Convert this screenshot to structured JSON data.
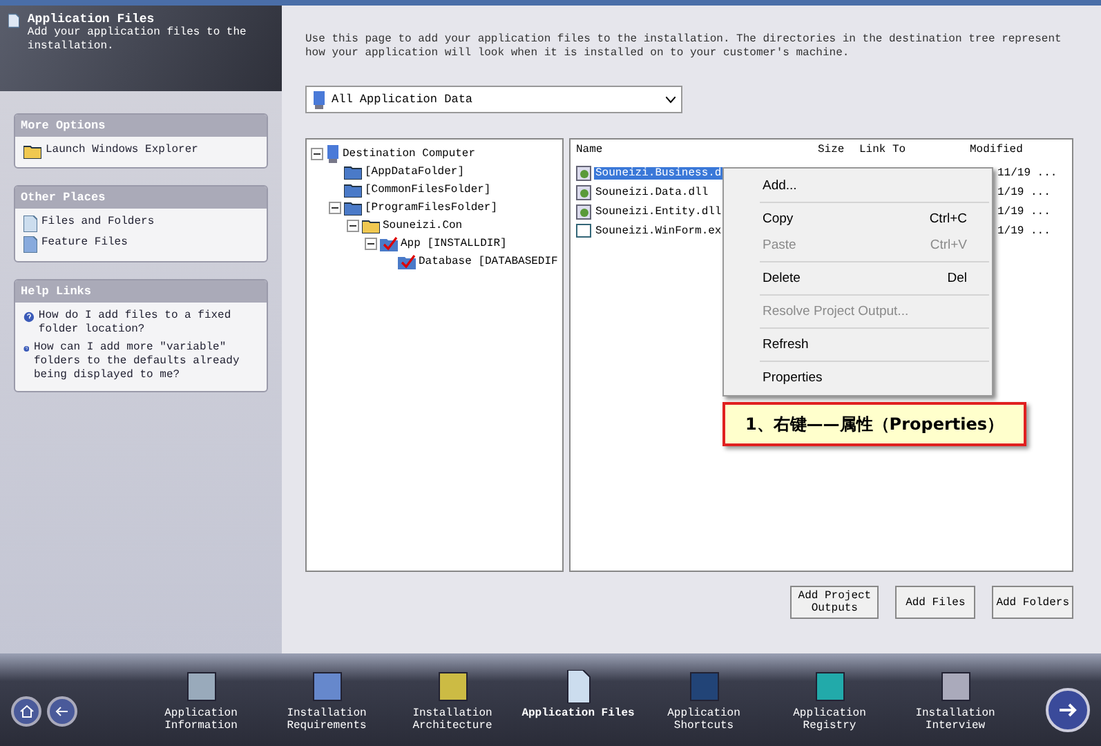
{
  "header": {
    "title": "Application Files",
    "subtitle": "Add your application files to the installation."
  },
  "sidebar": {
    "panels": [
      {
        "title": "More Options",
        "items": [
          {
            "label": "Launch Windows Explorer",
            "kind": "folder"
          }
        ]
      },
      {
        "title": "Other Places",
        "items": [
          {
            "label": "Files and Folders",
            "kind": "page"
          },
          {
            "label": "Feature Files",
            "kind": "feature"
          }
        ]
      },
      {
        "title": "Help Links",
        "items": [
          {
            "label": "How do I add files to a fixed folder location?",
            "kind": "help"
          },
          {
            "label": "How can I add more \"variable\" folders to the defaults already being displayed to me?",
            "kind": "help"
          }
        ]
      }
    ]
  },
  "intro": "Use this page to add your application files to the installation. The directories in the destination tree represent how your application will look when it is installed on to your customer's machine.",
  "dropdown": {
    "value": "All Application Data"
  },
  "tree": [
    {
      "label": "Destination Computer",
      "kind": "computer",
      "expanded": true,
      "children": [
        {
          "label": "[AppDataFolder]",
          "kind": "folder"
        },
        {
          "label": "[CommonFilesFolder]",
          "kind": "folder"
        },
        {
          "label": "[ProgramFilesFolder]",
          "kind": "folder",
          "expanded": true,
          "children": [
            {
              "label": "Souneizi.Con",
              "kind": "yellow-folder",
              "expanded": true,
              "children": [
                {
                  "label": "App [INSTALLDIR]",
                  "kind": "checked-folder",
                  "expanded": true,
                  "children": [
                    {
                      "label": "Database [DATABASEDIF",
                      "kind": "checked-folder"
                    }
                  ]
                }
              ]
            }
          ]
        }
      ]
    }
  ],
  "files": {
    "columns": [
      "Name",
      "Size",
      "Link To",
      "Modified"
    ],
    "rows": [
      {
        "name": "Souneizi.Business.d",
        "modified": "11/19 ...",
        "kind": "dll",
        "selected": true
      },
      {
        "name": "Souneizi.Data.dll",
        "modified": "1/19 ...",
        "kind": "dll",
        "selected": false
      },
      {
        "name": "Souneizi.Entity.dll",
        "modified": "1/19 ...",
        "kind": "dll",
        "selected": false
      },
      {
        "name": "Souneizi.WinForm.ex",
        "modified": "1/19 ...",
        "kind": "exe",
        "selected": false
      }
    ]
  },
  "context_menu": [
    {
      "label": "Add...",
      "disabled": false
    },
    {
      "kind": "separator"
    },
    {
      "label": "Copy",
      "shortcut": "Ctrl+C",
      "disabled": false
    },
    {
      "label": "Paste",
      "shortcut": "Ctrl+V",
      "disabled": true
    },
    {
      "kind": "separator"
    },
    {
      "label": "Delete",
      "shortcut": "Del",
      "disabled": false
    },
    {
      "kind": "separator"
    },
    {
      "label": "Resolve Project Output...",
      "disabled": true
    },
    {
      "kind": "separator"
    },
    {
      "label": "Refresh",
      "disabled": false
    },
    {
      "kind": "separator"
    },
    {
      "label": "Properties",
      "disabled": false
    }
  ],
  "callout": "1、右键——属性（Properties）",
  "buttons": [
    "Add Project Outputs",
    "Add Files",
    "Add Folders"
  ],
  "nav": [
    {
      "label": "Application Information",
      "kind": "info",
      "selected": false
    },
    {
      "label": "Installation Requirements",
      "kind": "requirements",
      "selected": false
    },
    {
      "label": "Installation Architecture",
      "kind": "architecture",
      "selected": false
    },
    {
      "label": "Application Files",
      "kind": "files",
      "selected": true
    },
    {
      "label": "Application Shortcuts",
      "kind": "shortcuts",
      "selected": false
    },
    {
      "label": "Application Registry",
      "kind": "registry",
      "selected": false
    },
    {
      "label": "Installation Interview",
      "kind": "interview",
      "selected": false
    }
  ]
}
